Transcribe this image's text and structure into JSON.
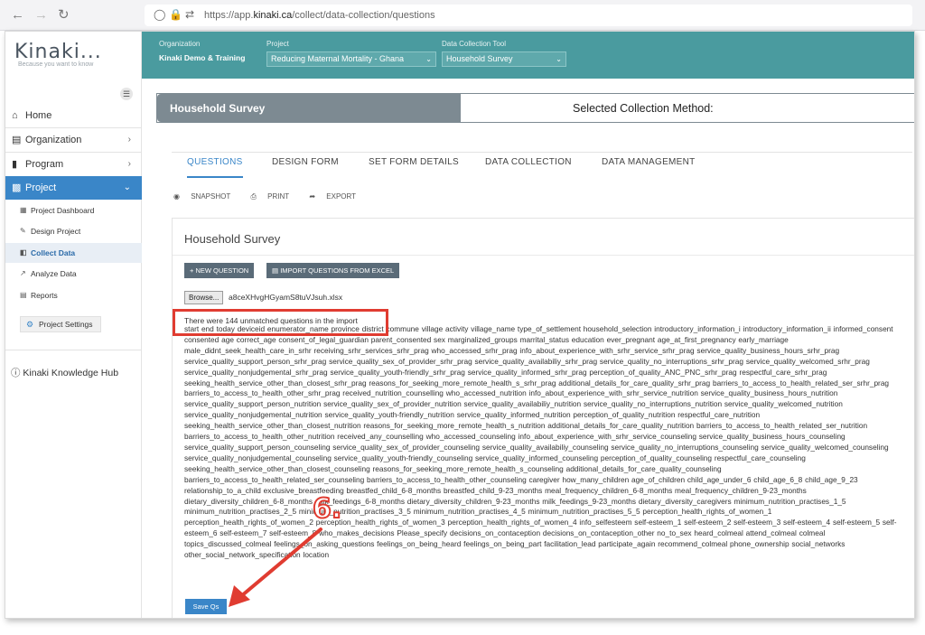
{
  "browser": {
    "url_prefix": "https://app.",
    "url_domain": "kinaki.ca",
    "url_path": "/collect/data-collection/questions"
  },
  "sidebar": {
    "logo": "Kinaki...",
    "tagline": "Because you want to know",
    "items": [
      {
        "label": "Home",
        "icon": "home-icon"
      },
      {
        "label": "Organization",
        "icon": "organization-icon"
      },
      {
        "label": "Program",
        "icon": "program-icon"
      },
      {
        "label": "Project",
        "icon": "project-icon"
      }
    ],
    "sub_items": [
      {
        "label": "Project Dashboard",
        "icon": "dashboard-icon"
      },
      {
        "label": "Design Project",
        "icon": "pencil-icon"
      },
      {
        "label": "Collect Data",
        "icon": "collect-icon"
      },
      {
        "label": "Analyze Data",
        "icon": "chart-icon"
      },
      {
        "label": "Reports",
        "icon": "report-icon"
      }
    ],
    "settings": "Project Settings",
    "hub": "Kinaki Knowledge Hub"
  },
  "header": {
    "org_label": "Organization",
    "org_value": "Kinaki Demo & Training",
    "project_label": "Project",
    "project_value": "Reducing Maternal Mortality - Ghana",
    "tool_label": "Data Collection Tool",
    "tool_value": "Household Survey"
  },
  "survey": {
    "title": "Household Survey",
    "method": "Selected Collection Method:"
  },
  "tabs": [
    "QUESTIONS",
    "DESIGN FORM",
    "SET FORM DETAILS",
    "DATA COLLECTION",
    "DATA MANAGEMENT"
  ],
  "tools": {
    "snapshot": "SNAPSHOT",
    "print": "PRINT",
    "export": "EXPORT"
  },
  "panel": {
    "title": "Household Survey",
    "new_question": "+ NEW QUESTION",
    "import": "IMPORT QUESTIONS FROM EXCEL",
    "browse": "Browse...",
    "file": "a8ceXHvgHGyamS8tuVJsuh.xlsx",
    "message": "There were 144 unmatched questions in the import",
    "unmatched": "start end today deviceid enumerator_name province district commune village activity village_name type_of_settlement household_selection introductory_information_i introductory_information_ii informed_consent consented age correct_age consent_of_legal_guardian parent_consented sex marginalized_groups marrital_status education ever_pregnant age_at_first_pregnancy early_marriage male_didnt_seek_health_care_in_srhr receiving_srhr_services_srhr_prag who_accessed_srhr_prag info_about_experience_with_srhr_service_srhr_prag service_quality_business_hours_srhr_prag service_quality_support_person_srhr_prag service_quality_sex_of_provider_srhr_prag service_quality_availabiliy_srhr_prag service_quality_no_interruptions_srhr_prag service_quality_welcomed_srhr_prag service_quality_nonjudgemental_srhr_prag service_quality_youth-friendly_srhr_prag service_quality_informed_srhr_prag perception_of_quality_ANC_PNC_srhr_prag respectful_care_srhr_prag seeking_health_service_other_than_closest_srhr_prag reasons_for_seeking_more_remote_health_s_srhr_prag additional_details_for_care_quality_srhr_prag barriers_to_access_to_health_related_ser_srhr_prag barriers_to_access_to_health_other_srhr_prag received_nutrition_counselling who_accessed_nutrition info_about_experience_with_srhr_service_nutrition service_quality_business_hours_nutrition service_quality_support_person_nutrition service_quality_sex_of_provider_nutrition service_quality_availabiliy_nutrition service_quality_no_interruptions_nutrition service_quality_welcomed_nutrition service_quality_nonjudgemental_nutrition service_quality_youth-friendly_nutrition service_quality_informed_nutrition perception_of_quality_nutrition respectful_care_nutrition seeking_health_service_other_than_closest_nutrition reasons_for_seeking_more_remote_health_s_nutrition additional_details_for_care_quality_nutrition barriers_to_access_to_health_related_ser_nutrition barriers_to_access_to_health_other_nutrition received_any_counselling who_accessed_counseling info_about_experience_with_srhr_service_counseling service_quality_business_hours_counseling service_quality_support_person_counseling service_quality_sex_of_provider_counseling service_quality_availabiliy_counseling service_quality_no_interruptions_counseling service_quality_welcomed_counseling service_quality_nonjudgemental_counseling service_quality_youth-friendly_counseling service_quality_informed_counseling perception_of_quality_counseling respectful_care_counseling seeking_health_service_other_than_closest_counseling reasons_for_seeking_more_remote_health_s_counseling additional_details_for_care_quality_counseling barriers_to_access_to_health_related_ser_counseling barriers_to_access_to_health_other_counseling caregiver how_many_children age_of_children child_age_under_6 child_age_6_8 child_age_9_23 relationship_to_a_child exclusive_breastfeeding breastfed_child_6-8_months breastfed_child_9-23_months meal_frequency_children_6-8_months meal_frequency_children_9-23_months dietary_diversity_children_6-8_months milk_feedings_6-8_months dietary_diversity_children_9-23_months milk_feedings_9-23_months dietary_diversity_caregivers minimum_nutrition_practises_1_5 minimum_nutrition_practises_2_5 minimum_nutrition_practises_3_5 minimum_nutrition_practises_4_5 minimum_nutrition_practises_5_5 perception_health_rights_of_women_1 perception_health_rights_of_women_2 perception_health_rights_of_women_3 perception_health_rights_of_women_4 info_selfesteem self-esteem_1 self-esteem_2 self-esteem_3 self-esteem_4 self-esteem_5 self-esteem_6 self-esteem_7 self-esteem_8 who_makes_decisions Please_specify decisions_on_contaception decisions_on_contaception_other no_to_sex heard_colmeal attend_colmeal colmeal topics_discussed_colmeal feelings_on_asking_questions feelings_on_being_heard feelings_on_being_part facilitation_lead participate_again recommend_colmeal phone_ownership social_networks other_social_network_specification location",
    "save": "Save Qs"
  },
  "annotation": {
    "step": "6.",
    "color": "#e03c31"
  },
  "colors": {
    "teal": "#4a9b9f",
    "blue": "#3a86c8",
    "slate": "#7d8a92"
  }
}
